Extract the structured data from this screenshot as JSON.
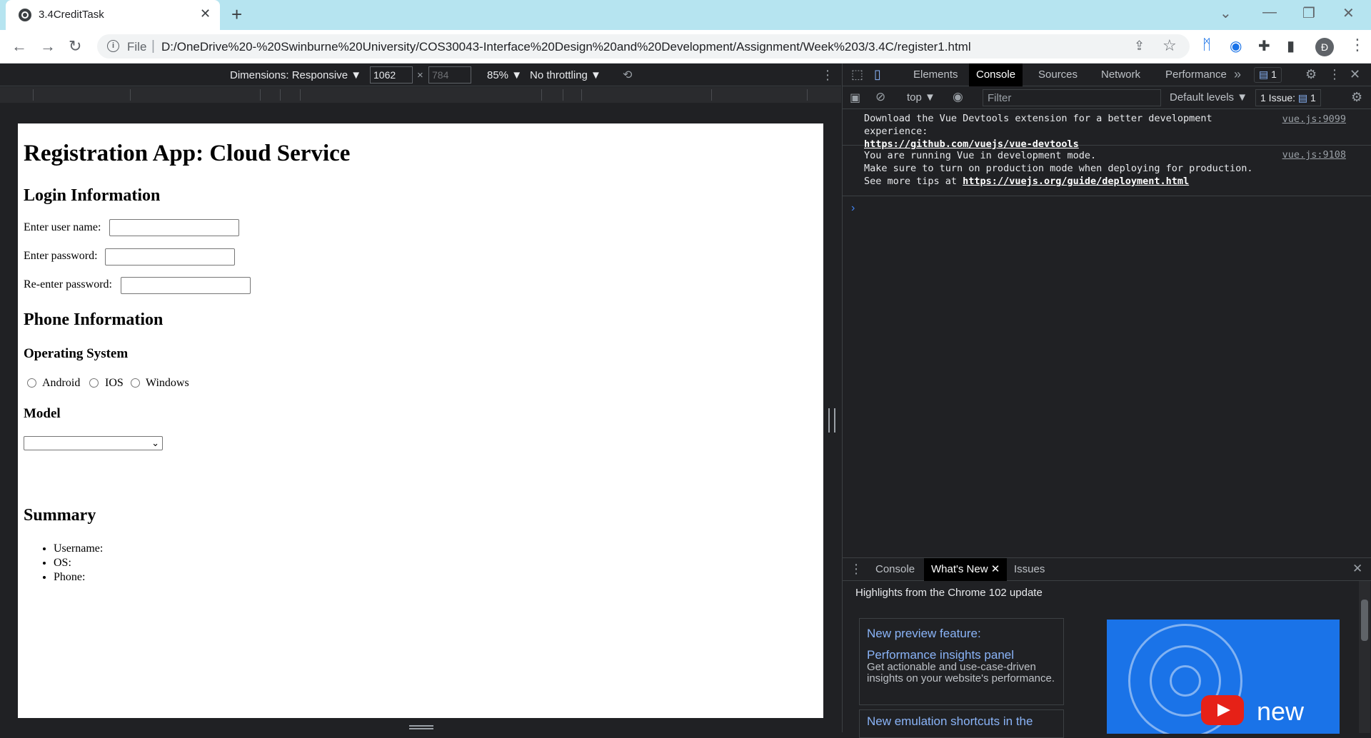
{
  "browser": {
    "tab_title": "3.4CreditTask",
    "new_tab_icon": "+",
    "address": {
      "scheme_label": "File",
      "url": "D:/OneDrive%20-%20Swinburne%20University/COS30043-Interface%20Design%20and%20Development/Assignment/Week%203/3.4C/register1.html"
    },
    "avatar_letter": "Đ"
  },
  "device_toolbar": {
    "dimensions_label": "Dimensions: Responsive ▼",
    "width": "1062",
    "height": "784",
    "times": "×",
    "zoom": "85% ▼",
    "throttling": "No throttling ▼"
  },
  "page": {
    "title": "Registration App: Cloud Service",
    "login_heading": "Login Information",
    "username_label": "Enter user name:",
    "password_label": "Enter password:",
    "reenter_label": "Re-enter password:",
    "phone_heading": "Phone Information",
    "os_heading": "Operating System",
    "os_options": [
      "Android",
      "IOS",
      "Windows"
    ],
    "model_heading": "Model",
    "summary_heading": "Summary",
    "summary_items": [
      "Username:",
      "OS:",
      "Phone:"
    ]
  },
  "devtools": {
    "tabs": [
      "Elements",
      "Console",
      "Sources",
      "Network",
      "Performance"
    ],
    "active_tab": "Console",
    "issues_badge": "1",
    "context": "top ▼",
    "filter_placeholder": "Filter",
    "levels": "Default levels ▼",
    "issues_label": "1 Issue:",
    "issues_count": "1",
    "logs": [
      {
        "text_1": "Download the Vue Devtools extension for a better development",
        "text_2": "experience:",
        "link": "https://github.com/vuejs/vue-devtools",
        "source": "vue.js:9099"
      },
      {
        "text_1": "You are running Vue in development mode.",
        "text_2": "Make sure to turn on production mode when deploying for production.",
        "text_3": "See more tips at ",
        "link": "https://vuejs.org/guide/deployment.html",
        "source": "vue.js:9108"
      }
    ],
    "prompt": "›",
    "drawer": {
      "tabs": [
        "Console",
        "What's New",
        "Issues"
      ],
      "active_tab": "What's New",
      "highlights": "Highlights from the Chrome 102 update",
      "card1_title_1": "New preview feature:",
      "card1_title_2": "Performance insights panel",
      "card1_body": "Get actionable and use-case-driven insights on your website's performance.",
      "card2_title": "New emulation shortcuts in the",
      "promo_text": "new"
    }
  }
}
